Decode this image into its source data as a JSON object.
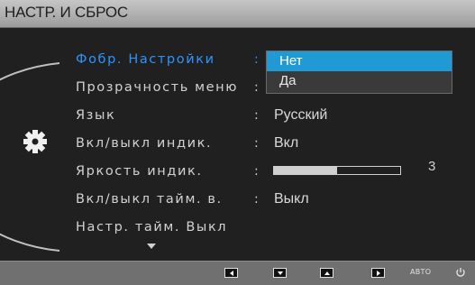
{
  "header": {
    "title": "НАСТР. И СБРОС"
  },
  "icons": {
    "section": "gear-icon",
    "more": "chevron-down-icon",
    "power": "power-icon"
  },
  "menu": {
    "items": [
      {
        "label": "Фобр. Настройки",
        "separator": ":",
        "value": "",
        "active": true
      },
      {
        "label": "Прозрачность меню",
        "separator": ":",
        "value": ""
      },
      {
        "label": "Язык",
        "separator": ":",
        "value": "Русский"
      },
      {
        "label": "Вкл/выкл индик.",
        "separator": ":",
        "value": "Вкл"
      },
      {
        "label": "Яркость индик.",
        "separator": ":",
        "value": ""
      },
      {
        "label": "Вкл/выкл тайм. в.",
        "separator": ":",
        "value": "Выкл"
      },
      {
        "label": "Настр. тайм. Выкл",
        "separator": "",
        "value": ""
      }
    ]
  },
  "dropdown": {
    "options": [
      "Нет",
      "Да"
    ],
    "selected": "Нет"
  },
  "brightness": {
    "level": 3,
    "fill_fraction": 0.5
  },
  "footer": {
    "auto_label": "АВТО",
    "buttons": [
      "left",
      "down",
      "up",
      "enter"
    ]
  },
  "colors": {
    "active": "#2b95ff",
    "highlight": "#1f9ad4",
    "title_bar": "#b4b4b4",
    "bottom_bar": "#707070"
  }
}
